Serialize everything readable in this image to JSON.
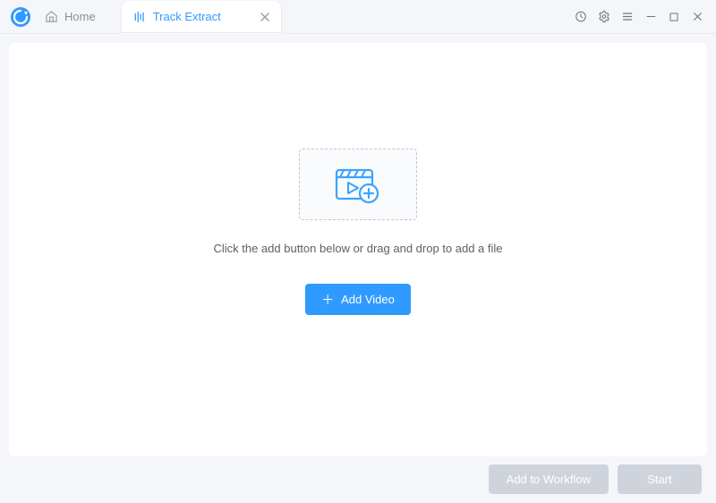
{
  "colors": {
    "accent": "#2f9aff",
    "muted": "#8a8f99",
    "disabled": "#cfd4dc"
  },
  "titlebar": {
    "tabs": {
      "home": {
        "label": "Home"
      },
      "active": {
        "label": "Track Extract"
      }
    }
  },
  "main": {
    "instruction": "Click the add button below or drag and drop to add a file",
    "add_button": "Add Video"
  },
  "footer": {
    "workflow": "Add to Workflow",
    "start": "Start"
  }
}
